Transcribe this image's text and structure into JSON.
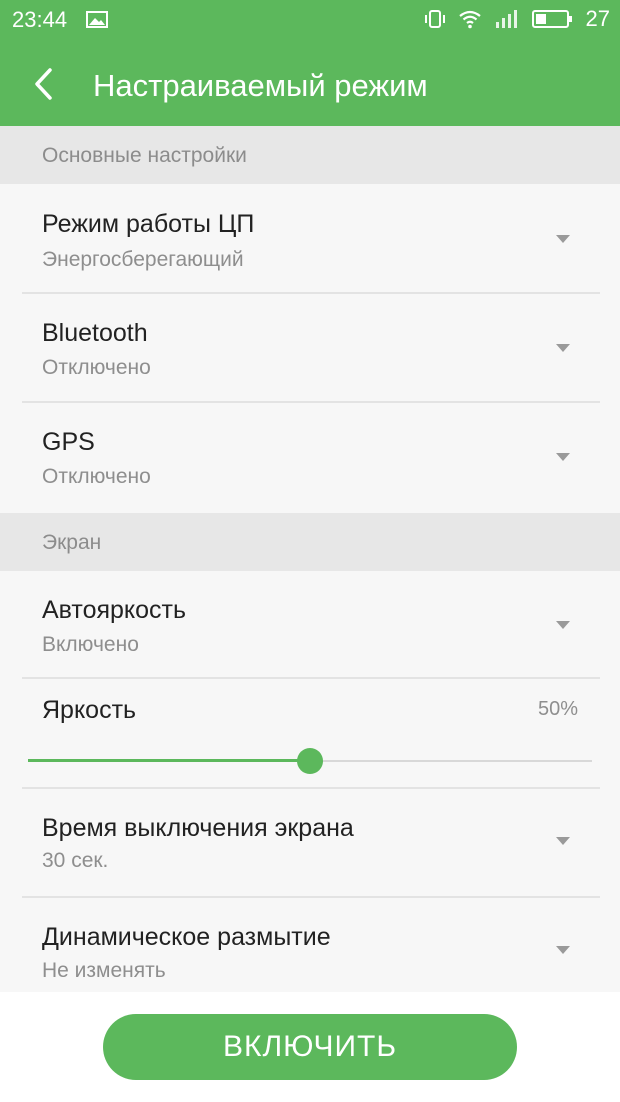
{
  "status_bar": {
    "time": "23:44",
    "battery": "27",
    "icons": [
      "image-icon",
      "vibrate-icon",
      "wifi-icon",
      "signal-icon",
      "battery-icon"
    ]
  },
  "header": {
    "title": "Настраиваемый режим",
    "back_icon": "chevron-left-icon"
  },
  "sections": {
    "basic": {
      "title": "Основные настройки",
      "items": [
        {
          "label": "Режим работы ЦП",
          "value": "Энергосберегающий"
        },
        {
          "label": "Bluetooth",
          "value": "Отключено"
        },
        {
          "label": "GPS",
          "value": "Отключено"
        }
      ]
    },
    "screen": {
      "title": "Экран",
      "autobrightness": {
        "label": "Автояркость",
        "value": "Включено"
      },
      "brightness": {
        "label": "Яркость",
        "percent_text": "50%",
        "level": 0.5
      },
      "timeout": {
        "label": "Время выключения экрана",
        "value": "30 сек."
      },
      "blur": {
        "label": "Динамическое размытие",
        "value": "Не изменять"
      }
    }
  },
  "footer": {
    "enable_label": "ВКЛЮЧИТЬ"
  },
  "colors": {
    "accent": "#5cb85c",
    "section_bg": "#e7e7e7",
    "list_bg": "#f7f7f7"
  }
}
